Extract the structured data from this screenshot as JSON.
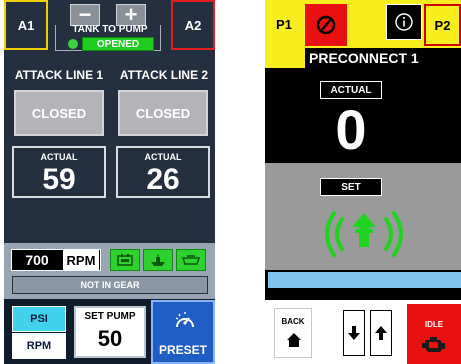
{
  "left_panel": {
    "a1_label": "A1",
    "a2_label": "A2",
    "tank_to_pump_label": "TANK TO PUMP",
    "tank_status": "OPENED",
    "attack_line_1": {
      "title": "ATTACK LINE 1",
      "state": "CLOSED",
      "actual_label": "ACTUAL",
      "actual_value": "59"
    },
    "attack_line_2": {
      "title": "ATTACK LINE 2",
      "state": "CLOSED",
      "actual_label": "ACTUAL",
      "actual_value": "26"
    },
    "rpm_value": "700",
    "rpm_unit": "RPM",
    "gear_status": "NOT IN GEAR",
    "psi_button": "PSI",
    "rpm_button": "RPM",
    "set_pump_label": "SET PUMP",
    "set_pump_value": "50",
    "preset_label": "PRESET"
  },
  "right_panel": {
    "p1_label": "P1",
    "p2_label": "P2",
    "title": "PRECONNECT 1",
    "actual_label": "ACTUAL",
    "actual_value": "0",
    "set_label": "SET",
    "back_label": "BACK",
    "idle_label": "IDLE"
  },
  "colors": {
    "panel_dark": "#243040",
    "yellow": "#f7ee1f",
    "red": "#e81010",
    "green": "#2ed12e",
    "cyan": "#41d3ec",
    "preset_blue": "#1d5dc4",
    "light_blue_bar": "#80c5ee"
  },
  "icons": [
    "minus-icon",
    "plus-icon",
    "pump-engaged-icon",
    "ship-icon",
    "tank-icon",
    "gauge-icon",
    "disable-icon",
    "info-icon",
    "signal-broadcast-icon",
    "home-icon",
    "arrow-down-icon",
    "arrow-up-icon",
    "engine-icon"
  ]
}
